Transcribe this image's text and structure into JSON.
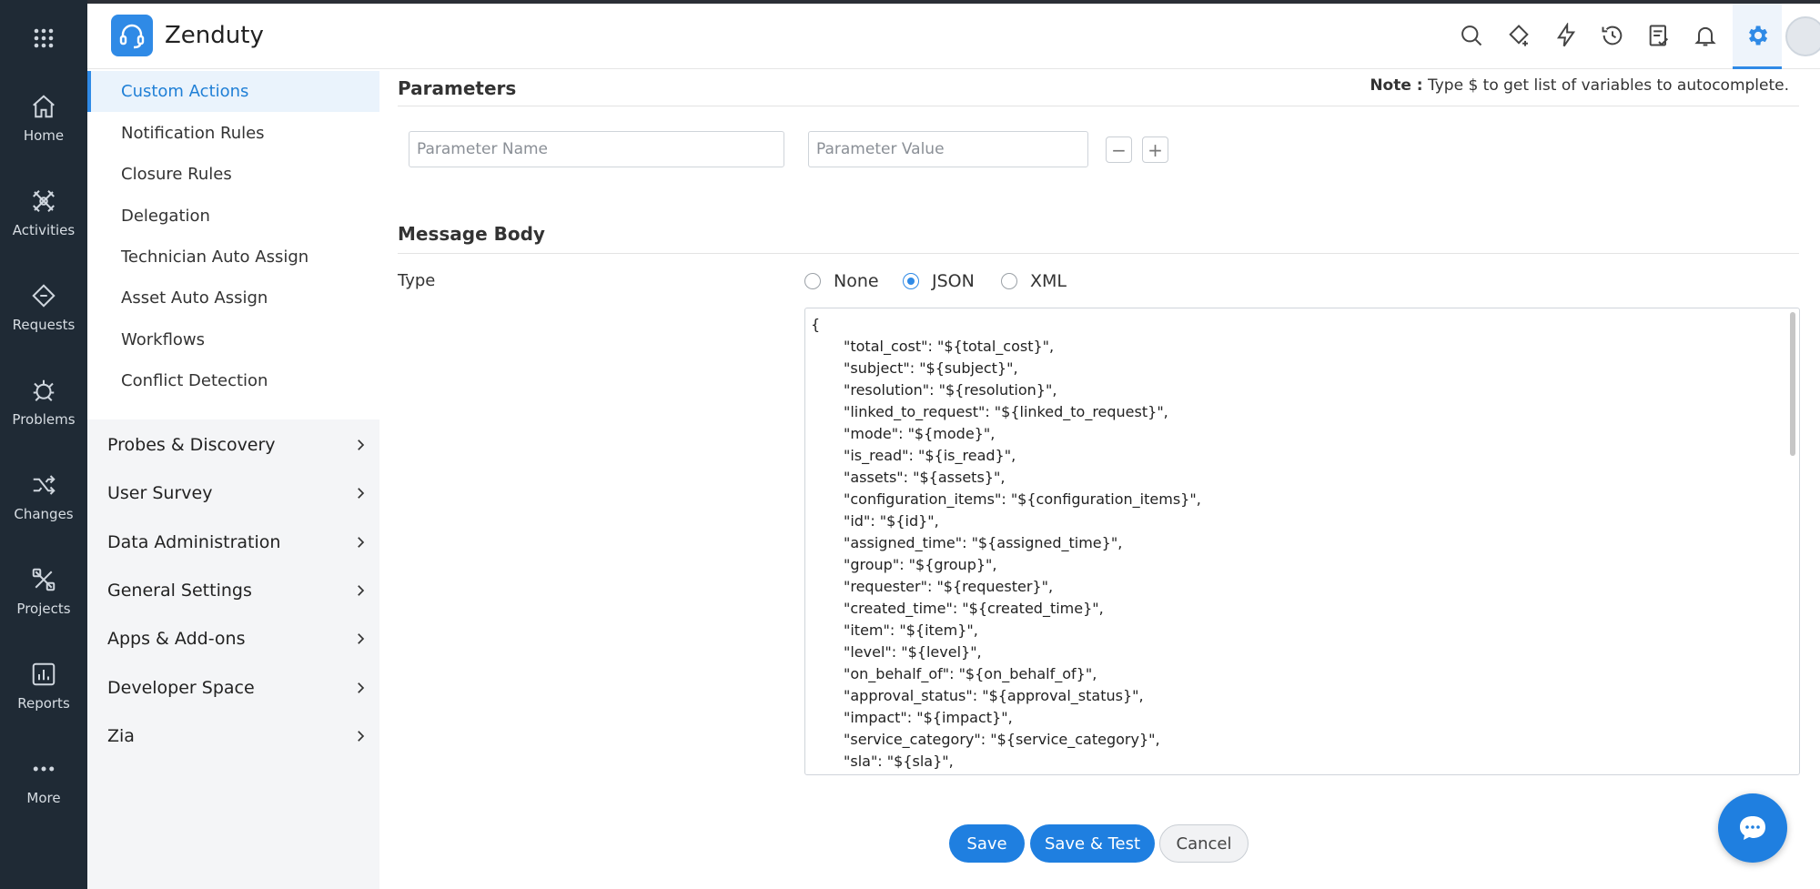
{
  "header": {
    "brand": "Zenduty",
    "icons": [
      "search-icon",
      "tag-sparkle-icon",
      "lightning-icon",
      "history-icon",
      "checklist-icon",
      "bell-icon",
      "gear-icon"
    ]
  },
  "rail": {
    "items": [
      {
        "label": "Home",
        "icon": "home-icon"
      },
      {
        "label": "Activities",
        "icon": "activities-icon"
      },
      {
        "label": "Requests",
        "icon": "requests-icon"
      },
      {
        "label": "Problems",
        "icon": "problems-icon"
      },
      {
        "label": "Changes",
        "icon": "changes-icon"
      },
      {
        "label": "Projects",
        "icon": "projects-icon"
      },
      {
        "label": "Reports",
        "icon": "reports-icon"
      },
      {
        "label": "More",
        "icon": "more-icon"
      }
    ]
  },
  "sidebar": {
    "sub_items": [
      {
        "label": "Custom Actions",
        "active": true
      },
      {
        "label": "Notification Rules"
      },
      {
        "label": "Closure Rules"
      },
      {
        "label": "Delegation"
      },
      {
        "label": "Technician Auto Assign"
      },
      {
        "label": "Asset Auto Assign"
      },
      {
        "label": "Workflows"
      },
      {
        "label": "Conflict Detection"
      }
    ],
    "sections": [
      {
        "label": "Probes & Discovery"
      },
      {
        "label": "User Survey"
      },
      {
        "label": "Data Administration"
      },
      {
        "label": "General Settings"
      },
      {
        "label": "Apps & Add-ons"
      },
      {
        "label": "Developer Space"
      },
      {
        "label": "Zia"
      }
    ]
  },
  "main": {
    "parameters_title": "Parameters",
    "note_label": "Note :",
    "note_text": " Type $ to get list of variables to autocomplete.",
    "param_name_placeholder": "Parameter Name",
    "param_value_placeholder": "Parameter Value",
    "minus_label": "−",
    "plus_label": "+",
    "message_body_title": "Message Body",
    "type_label": "Type",
    "type_options": [
      {
        "label": "None",
        "checked": false
      },
      {
        "label": "JSON",
        "checked": true
      },
      {
        "label": "XML",
        "checked": false
      }
    ],
    "body_lines": [
      "{",
      "\"total_cost\": \"${total_cost}\",",
      "\"subject\": \"${subject}\",",
      "\"resolution\": \"${resolution}\",",
      "\"linked_to_request\": \"${linked_to_request}\",",
      "\"mode\": \"${mode}\",",
      "\"is_read\": \"${is_read}\",",
      "\"assets\": \"${assets}\",",
      "\"configuration_items\": \"${configuration_items}\",",
      "\"id\": \"${id}\",",
      "\"assigned_time\": \"${assigned_time}\",",
      "\"group\": \"${group}\",",
      "\"requester\": \"${requester}\",",
      "\"created_time\": \"${created_time}\",",
      "\"item\": \"${item}\",",
      "\"level\": \"${level}\",",
      "\"on_behalf_of\": \"${on_behalf_of}\",",
      "\"approval_status\": \"${approval_status}\",",
      "\"impact\": \"${impact}\",",
      "\"service_category\": \"${service_category}\",",
      "\"sla\": \"${sla}\","
    ],
    "buttons": {
      "save": "Save",
      "save_test": "Save & Test",
      "cancel": "Cancel"
    }
  },
  "colors": {
    "accent": "#2f8ae6",
    "rail_bg": "#1f2a35",
    "sidebar_active_bg": "#eaf3fc"
  }
}
